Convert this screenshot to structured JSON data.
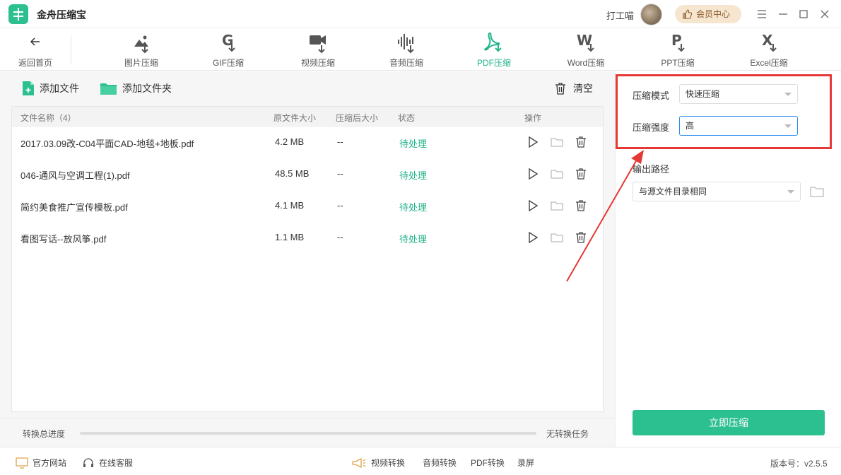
{
  "app": {
    "name": "金舟压缩宝",
    "user_name": "打工喵",
    "vip_label": "会员中心",
    "accent_color": "#2cbf8f",
    "active_color": "#22b38a"
  },
  "toolbar": {
    "back_label": "返回首页",
    "tools": [
      {
        "label": "图片压缩",
        "icon": "image-compress-icon"
      },
      {
        "label": "GIF压缩",
        "icon": "gif-compress-icon"
      },
      {
        "label": "视频压缩",
        "icon": "video-compress-icon"
      },
      {
        "label": "音频压缩",
        "icon": "audio-compress-icon"
      },
      {
        "label": "PDF压缩",
        "icon": "pdf-compress-icon",
        "active": true
      },
      {
        "label": "Word压缩",
        "icon": "word-compress-icon"
      },
      {
        "label": "PPT压缩",
        "icon": "ppt-compress-icon"
      },
      {
        "label": "Excel压缩",
        "icon": "excel-compress-icon"
      }
    ]
  },
  "actions": {
    "add_file": "添加文件",
    "add_folder": "添加文件夹",
    "clear": "清空"
  },
  "table": {
    "headers": {
      "name": "文件名称（4）",
      "original_size": "原文件大小",
      "compressed_size": "压缩后大小",
      "status": "状态",
      "operation": "操作"
    },
    "rows": [
      {
        "name": "2017.03.09改-C04平面CAD-地毯+地板.pdf",
        "size": "4.2 MB",
        "compressed": "--",
        "status": "待处理"
      },
      {
        "name": "046-通风与空调工程(1).pdf",
        "size": "48.5 MB",
        "compressed": "--",
        "status": "待处理"
      },
      {
        "name": "简约美食推广宣传模板.pdf",
        "size": "4.1 MB",
        "compressed": "--",
        "status": "待处理"
      },
      {
        "name": "看图写话--放风筝.pdf",
        "size": "1.1 MB",
        "compressed": "--",
        "status": "待处理"
      }
    ]
  },
  "progress": {
    "label": "转换总进度",
    "value": 0,
    "status": "无转换任务"
  },
  "settings": {
    "mode_label": "压缩模式",
    "mode_value": "快速压缩",
    "strength_label": "压缩强度",
    "strength_value": "高",
    "output_label": "输出路径",
    "output_value": "与源文件目录相同",
    "compress_button": "立即压缩"
  },
  "footer": {
    "website": "官方网站",
    "support": "在线客服",
    "links": [
      "视频转换",
      "音频转换",
      "PDF转换",
      "录屏"
    ],
    "version": "版本号：v2.5.5"
  }
}
